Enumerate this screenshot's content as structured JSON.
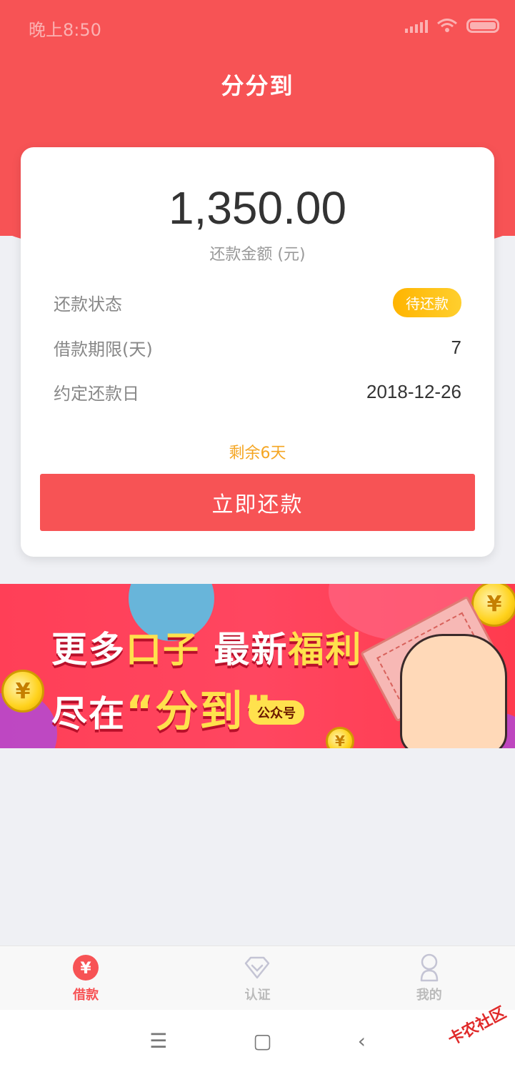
{
  "status": {
    "time": "晚上8:50"
  },
  "header": {
    "title": "分分到"
  },
  "card": {
    "amount": "1,350.00",
    "amount_label": "还款金额 (元)",
    "rows": [
      {
        "label": "还款状态",
        "value": "待还款"
      },
      {
        "label": "借款期限(天)",
        "value": "7"
      },
      {
        "label": "约定还款日",
        "value": "2018-12-26"
      }
    ],
    "remaining": "剩余6天",
    "pay_button": "立即还款"
  },
  "banner": {
    "line1_a": "更多",
    "line1_b": "口子",
    "line1_c": " 最新",
    "line1_d": "福利",
    "line2_a": "尽在",
    "line2_b": "“分到”",
    "tag": "公众号"
  },
  "tabbar": {
    "items": [
      {
        "label": "借款",
        "icon": "yen-icon",
        "active": true
      },
      {
        "label": "认证",
        "icon": "diamond-icon",
        "active": false
      },
      {
        "label": "我的",
        "icon": "user-icon",
        "active": false
      }
    ]
  },
  "sysnav": {
    "menu": "☰",
    "home": "▢",
    "back": "‹"
  },
  "watermark": "卡农社区",
  "colors": {
    "brand": "#f75355",
    "badge": "#ffb400",
    "remaining": "#f5a623"
  }
}
